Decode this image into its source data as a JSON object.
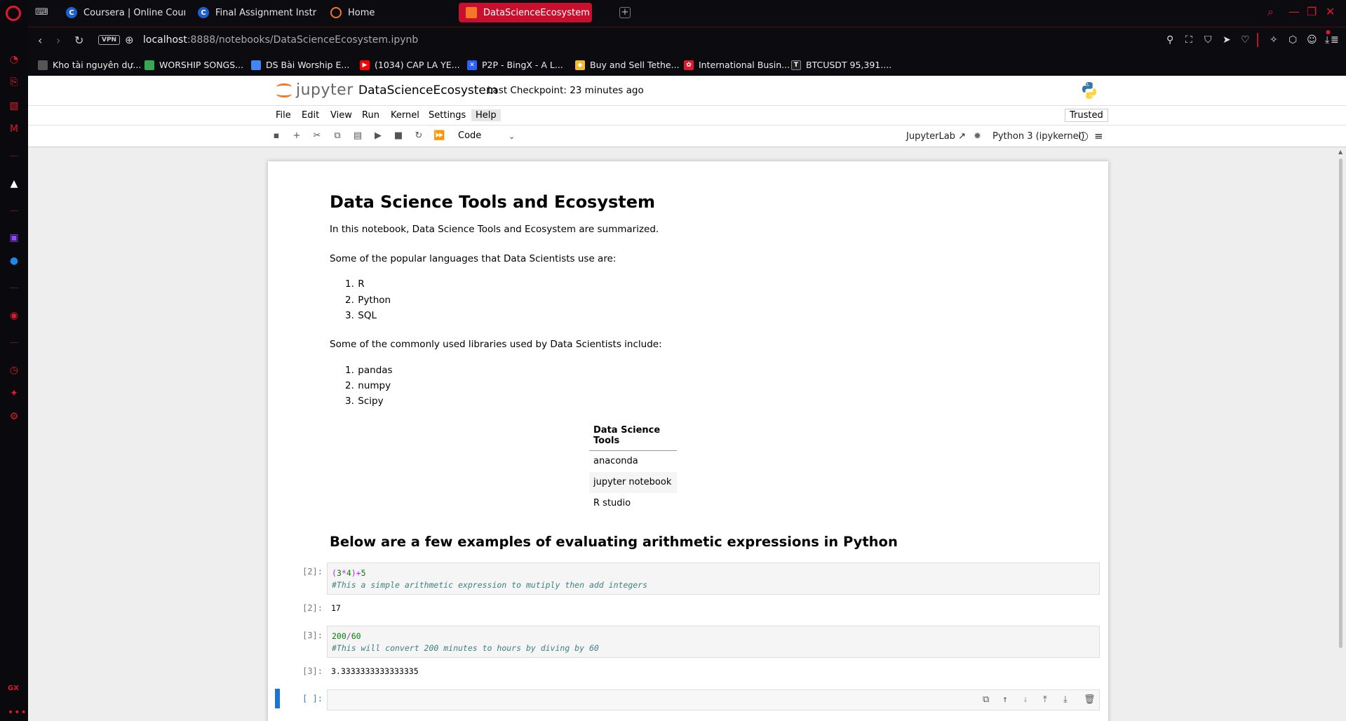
{
  "tabs": [
    {
      "label": "Coursera | Online Course...",
      "icon": "coursera-icon",
      "active": false
    },
    {
      "label": "Final Assignment Instruct...",
      "icon": "coursera-icon",
      "active": false
    },
    {
      "label": "Home",
      "icon": "jupyter-icon",
      "active": false
    },
    {
      "label": "DataScienceEcosystem",
      "icon": "jupyter-icon",
      "active": true
    }
  ],
  "address": {
    "vpn": "VPN",
    "host": "localhost",
    "path": ":8888/notebooks/DataScienceEcosystem.ipynb"
  },
  "bookmarks": [
    {
      "label": "Kho tài nguyên dự...",
      "color": "#cccccc"
    },
    {
      "label": "WORSHIP SONGS...",
      "color": "#34a853"
    },
    {
      "label": "DS Bài Worship E...",
      "color": "#4285f4"
    },
    {
      "label": "(1034) CAP LA YE...",
      "color": "#ff0000"
    },
    {
      "label": "P2P - BingX - A L...",
      "color": "#2962ff"
    },
    {
      "label": "Buy and Sell Tethe...",
      "color": "#f3ba2f"
    },
    {
      "label": "International Busin...",
      "color": "#e0192d"
    },
    {
      "label": "BTCUSDT 95,391....",
      "color": "#ffffff"
    }
  ],
  "jupyter": {
    "logo": "jupyter",
    "notebook_title": "DataScienceEcosystem",
    "checkpoint": "Last Checkpoint: 23 minutes ago",
    "menu": [
      "File",
      "Edit",
      "View",
      "Run",
      "Kernel",
      "Settings",
      "Help"
    ],
    "trusted": "Trusted",
    "cell_type": "Code",
    "jupyterlab": "JupyterLab",
    "kernel": "Python 3 (ipykernel)"
  },
  "notebook": {
    "title": "Data Science Tools and Ecosystem",
    "intro": "In this notebook, Data Science Tools and Ecosystem are summarized.",
    "languages_intro": "Some of the popular languages that Data Scientists use are:",
    "languages": [
      "R",
      "Python",
      "SQL"
    ],
    "libraries_intro": "Some of the commonly used libraries used by Data Scientists include:",
    "libraries": [
      "pandas",
      "numpy",
      "Scipy"
    ],
    "tools_header": "Data Science Tools",
    "tools": [
      "anaconda",
      "jupyter notebook",
      "R studio"
    ],
    "arith_heading": "Below are a few examples of evaluating arithmetic expressions in Python",
    "cells": [
      {
        "prompt_in": "[2]:",
        "code_l1": "(3*4)+5",
        "code_l2": "#This a simple arithmetic expression to mutiply then add integers",
        "prompt_out": "[2]:",
        "output": "17"
      },
      {
        "prompt_in": "[3]:",
        "code_l1": "200/60",
        "code_l2": "#This will convert 200 minutes to hours by diving by 60",
        "prompt_out": "[3]:",
        "output": "3.3333333333333335"
      }
    ],
    "empty_prompt": "[ ]:"
  },
  "colors": {
    "opera_red": "#e0192d",
    "active_tab": "#c8102e",
    "jupyter_orange": "#f37726",
    "active_cell": "#1976d2"
  }
}
